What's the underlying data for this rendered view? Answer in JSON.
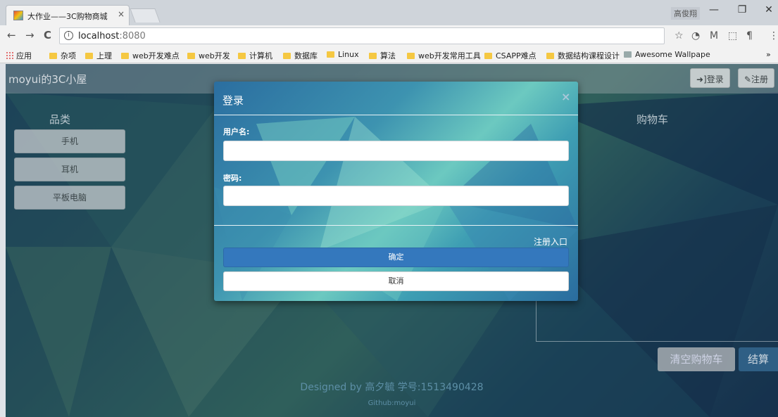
{
  "browser": {
    "tab_title": "大作业——3C购物商城",
    "tab_close": "×",
    "window_user": "高俊翔",
    "window_minimize": "—",
    "window_maximize": "❐",
    "window_close": "✕",
    "url_host": "localhost",
    "url_port": ":8080",
    "nav_back": "←",
    "nav_forward": "→",
    "nav_reload": "C",
    "info": "i",
    "bookmarks": [
      {
        "label": "应用",
        "type": "apps"
      },
      {
        "label": "杂项"
      },
      {
        "label": "上理"
      },
      {
        "label": "web开发难点"
      },
      {
        "label": "web开发"
      },
      {
        "label": "计算机"
      },
      {
        "label": "数据库"
      },
      {
        "label": "Linux"
      },
      {
        "label": "算法"
      },
      {
        "label": "web开发常用工具"
      },
      {
        "label": "CSAPP难点"
      },
      {
        "label": "数据结构课程设计"
      },
      {
        "label": "Awesome Wallpape"
      }
    ],
    "bookmarks_more": "»"
  },
  "site": {
    "brand": "moyui的3C小屋",
    "login_label": "➜]登录",
    "register_label": "✎注册",
    "categories_title": "品类",
    "categories": [
      "手机",
      "耳机",
      "平板电脑"
    ],
    "cart_title": "购物车",
    "clear_cart": "清空购物车",
    "checkout": "结算",
    "footer_line1": "Designed by 高夕毓 学号:1513490428",
    "footer_line2": "Github:moyui"
  },
  "modal": {
    "title": "登录",
    "close": "×",
    "username_label": "用户名:",
    "username_value": "",
    "password_label": "密码:",
    "password_value": "",
    "register_link": "注册入口",
    "confirm": "确定",
    "cancel": "取消"
  },
  "colors": {
    "modal_confirm": "#3478bd",
    "page_overlay": "rgba(0,0,0,0.38)"
  }
}
